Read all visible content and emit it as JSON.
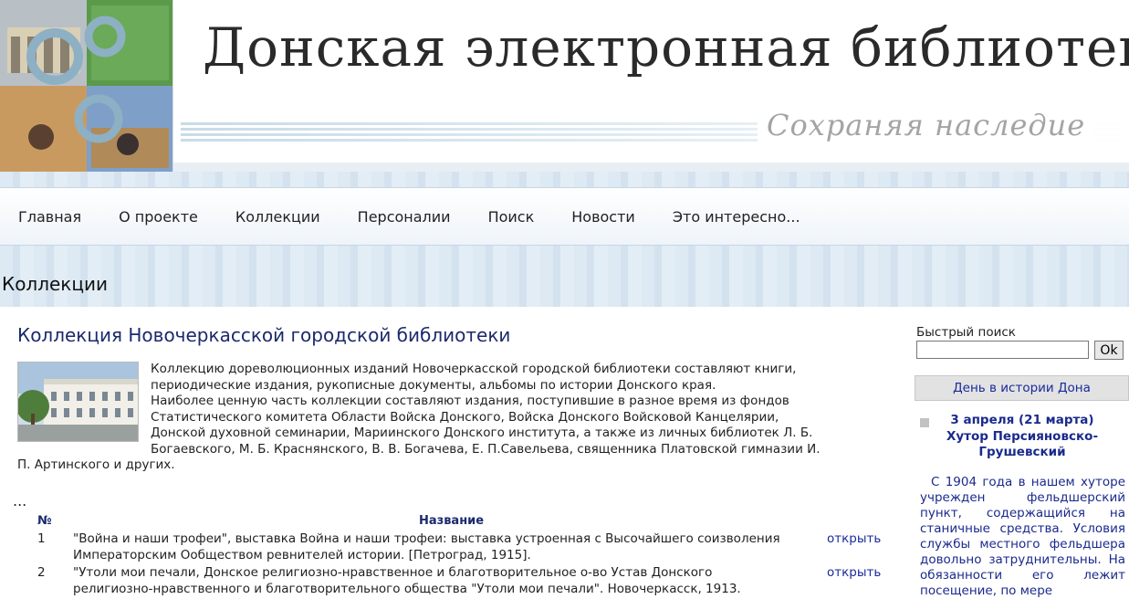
{
  "header": {
    "title": "Донская электронная библиотека",
    "tagline": "Сохраняя наследие"
  },
  "nav": [
    {
      "label": "Главная"
    },
    {
      "label": "О проекте"
    },
    {
      "label": "Коллекции"
    },
    {
      "label": "Персоналии"
    },
    {
      "label": "Поиск"
    },
    {
      "label": "Новости"
    },
    {
      "label": "Это интересно..."
    }
  ],
  "section": {
    "title": "Коллекции"
  },
  "collection": {
    "title": "Коллекция Новочеркасской городской библиотеки",
    "description": "Коллекцию дореволюционных изданий Новочеркасской городской библиотеки составляют книги, периодические издания, рукописные документы, альбомы по истории Донского края.",
    "description2": "Наиболее ценную часть коллекции составляют издания, поступившие в разное время из фондов Статистического комитета Области Войска Донского, Войска Донского Войсковой Канцелярии, Донской духовной семинарии, Мариинского Донского института, а также из личных библиотек Л. Б. Богаевского, М. Б. Краснянского, В. В. Богачева, Е. П.Савельева, священника Платовской гимназии И. П. Артинского и других.",
    "ellipsis": "...",
    "table_headers": {
      "num": "№",
      "name": "Название"
    },
    "items": [
      {
        "num": "1",
        "title": "\"Война и наши трофеи\", выставка Война и наши трофеи: выставка устроенная с Высочайшего соизволения Императорским Ообществом ревнителей истории. [Петроград, 1915].",
        "action": "открыть"
      },
      {
        "num": "2",
        "title": "\"Утоли мои печали, Донское религиозно-нравственное и благотворительное о-во Устав Донского религиозно-нравственного и благотворительного общества \"Утоли мои печали\". Новочеркасск, 1913.",
        "action": "открыть"
      }
    ]
  },
  "sidebar": {
    "quick_search_label": "Быстрый поиск",
    "quick_search_value": "",
    "ok_label": "Ok",
    "day_in_history": {
      "title": "День в истории Дона",
      "date": "3 апреля (21 марта)",
      "place": "Хутор Персияновско-Грушевский",
      "text": "С 1904 года в нашем хуторе учрежден фельдшерский пункт, содержащийся на станичные средства. Условия службы местного фельдшера довольно затруднительны. На обязанности его лежит посещение, по мере"
    }
  },
  "colors": {
    "link": "#1a2a9c",
    "heading": "#1a2a6c",
    "nav_band": "#dde9f3"
  }
}
